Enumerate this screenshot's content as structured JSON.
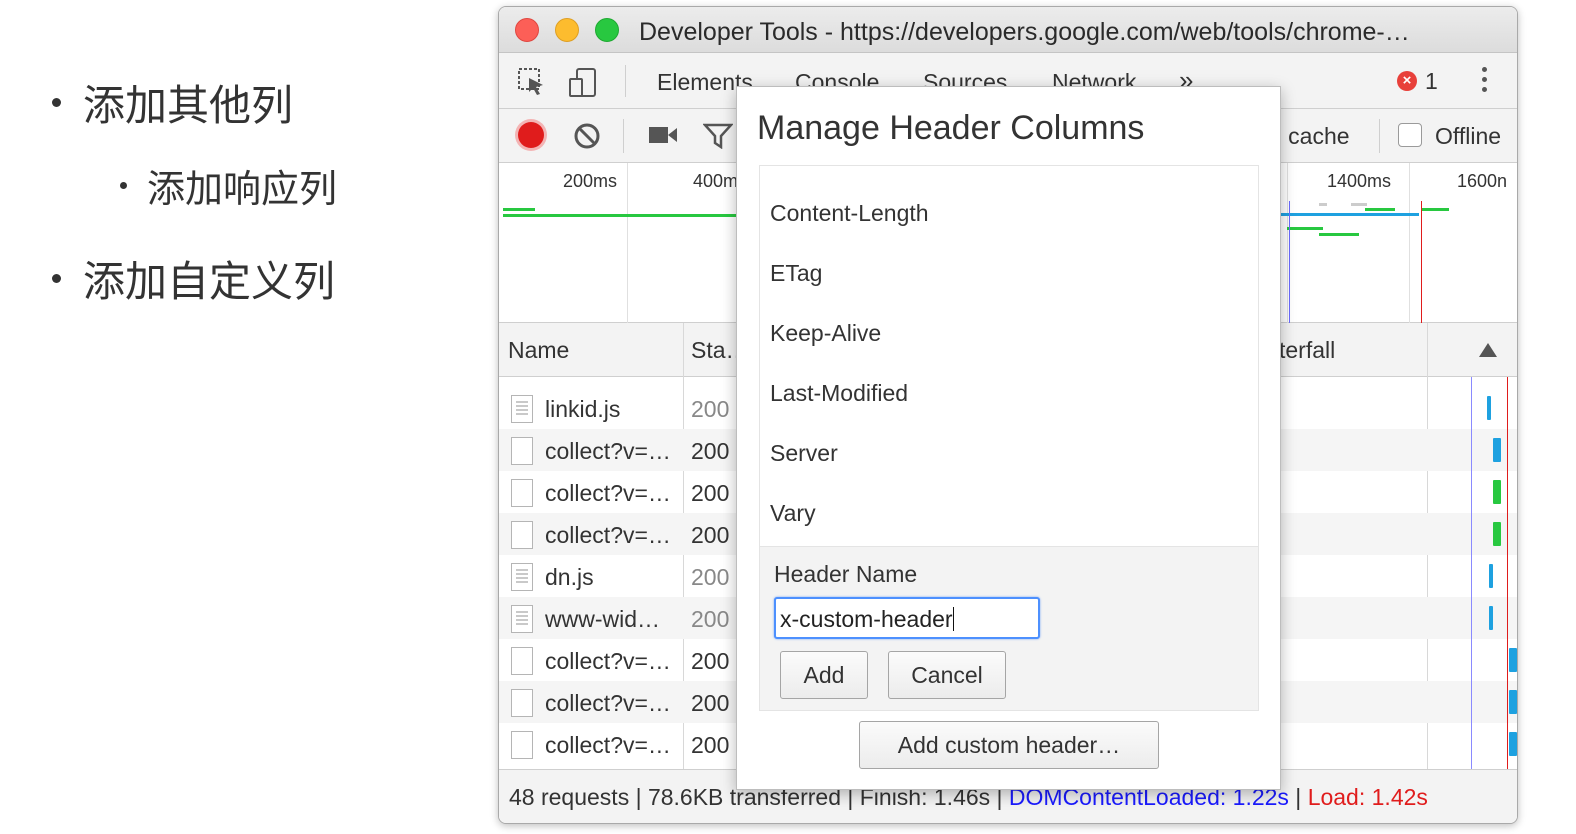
{
  "slide": {
    "bullets": [
      {
        "text": "添加其他列"
      },
      {
        "text": "添加响应列"
      },
      {
        "text": "添加自定义列"
      }
    ]
  },
  "window": {
    "title": "Developer Tools - https://developers.google.com/web/tools/chrome-…"
  },
  "tabs": {
    "items": [
      {
        "label": "Elements"
      },
      {
        "label": "Console"
      },
      {
        "label": "Sources"
      },
      {
        "label": "Network"
      }
    ],
    "more": "»",
    "error_count": "1"
  },
  "toolbar": {
    "cache_label": "e cache",
    "offline_label": "Offline"
  },
  "overview": {
    "ticks": [
      "200ms",
      "400m",
      "1400ms",
      "1600n"
    ]
  },
  "table": {
    "columns": {
      "name": "Name",
      "status": "Sta…",
      "waterfall": "terfall"
    },
    "rows": [
      {
        "name": "linkid.js",
        "status": "200",
        "type": "js"
      },
      {
        "name": "collect?v=…",
        "status": "200",
        "type": "doc"
      },
      {
        "name": "collect?v=…",
        "status": "200",
        "type": "doc"
      },
      {
        "name": "collect?v=…",
        "status": "200",
        "type": "doc"
      },
      {
        "name": "dn.js",
        "status": "200",
        "type": "js"
      },
      {
        "name": "www-wid…",
        "status": "200",
        "type": "js"
      },
      {
        "name": "collect?v=…",
        "status": "200",
        "type": "doc"
      },
      {
        "name": "collect?v=…",
        "status": "200",
        "type": "doc"
      },
      {
        "name": "collect?v=…",
        "status": "200",
        "type": "doc"
      }
    ]
  },
  "statusbar": {
    "summary": "48 requests | 78.6KB transferred | Finish: 1.46s | ",
    "dom_loaded": "DOMContentLoaded: 1.22s",
    "separator": " | ",
    "load": "Load: 1.42s"
  },
  "dialog": {
    "title": "Manage Header Columns",
    "items": [
      "Content-Length",
      "ETag",
      "Keep-Alive",
      "Last-Modified",
      "Server",
      "Vary"
    ],
    "form_label": "Header Name",
    "input_value": "x-custom-header",
    "add_label": "Add",
    "cancel_label": "Cancel",
    "custom_button": "Add custom header…"
  },
  "colors": {
    "record": "#e01c1c",
    "dom_loaded": "#1a1aff",
    "load": "#e01c1c",
    "input_focus": "#4d90fe"
  }
}
